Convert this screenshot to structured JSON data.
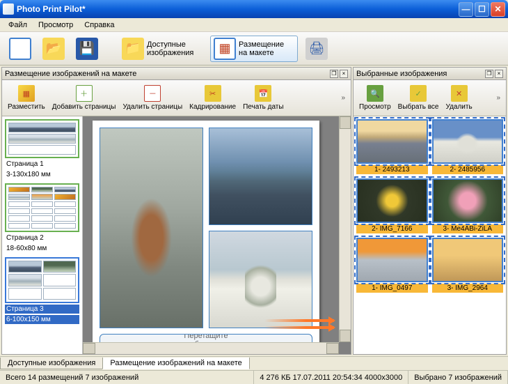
{
  "window": {
    "title": "Photo Print Pilot*"
  },
  "menu": {
    "file": "Файл",
    "view": "Просмотр",
    "help": "Справка"
  },
  "toolbar": {
    "available": "Доступные\nизображения",
    "layout": "Размещение\nна макете"
  },
  "panels": {
    "left_title": "Размещение изображений на макете",
    "right_title": "Выбранные изображения"
  },
  "left_toolbar": {
    "place": "Разместить",
    "add_pages": "Добавить страницы",
    "del_pages": "Удалить страницы",
    "crop": "Кадрирование",
    "date": "Печать даты"
  },
  "right_toolbar": {
    "view": "Просмотр",
    "select_all": "Выбрать все",
    "delete": "Удалить"
  },
  "pages": [
    {
      "title": "Страница 1",
      "sub": "3-130x180 мм"
    },
    {
      "title": "Страница 2",
      "sub": "18-60x80 мм"
    },
    {
      "title": "Страница 3",
      "sub": "6-100x150 мм"
    }
  ],
  "drop_hint": "Перетащите\nизображения",
  "thumbs": [
    {
      "cap": "1- 2493213"
    },
    {
      "cap": "2- 2485956"
    },
    {
      "cap": "2- IMG_7166"
    },
    {
      "cap": "3- Me4ABi-ZiLA"
    },
    {
      "cap": "1- IMG_0497"
    },
    {
      "cap": "3- IMG_2964"
    }
  ],
  "tabs": {
    "available": "Доступные изображения",
    "layout": "Размещение изображений на макете"
  },
  "status": {
    "summary": "Всего 14 размещений 7 изображений",
    "size": "4 276 КБ 17.07.2011 20:54:34 4000x3000",
    "selected": "Выбрано 7 изображений"
  }
}
